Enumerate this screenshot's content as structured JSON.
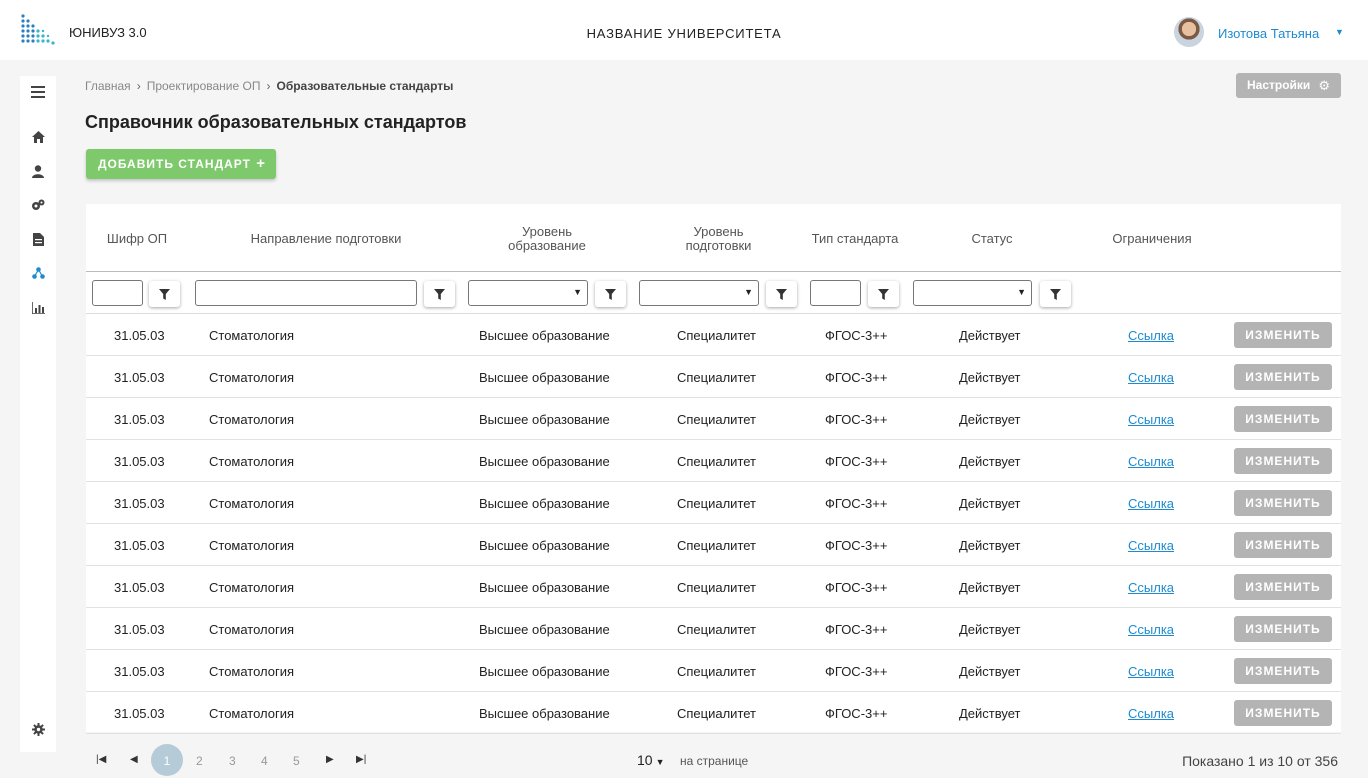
{
  "header": {
    "brand": "ЮНИВУЗ 3.0",
    "university": "НАЗВАНИЕ УНИВЕРСИТЕТА",
    "user_name": "Изотова Татьяна"
  },
  "sidebar": {
    "icons": [
      "menu-icon",
      "home-icon",
      "user-icon",
      "settings-gears-icon",
      "document-icon",
      "hierarchy-icon",
      "chart-icon",
      "gear-icon"
    ]
  },
  "breadcrumb": {
    "items": [
      "Главная",
      "Проектирование ОП",
      "Образовательные стандарты"
    ]
  },
  "settings_label": "Настройки",
  "page_title": "Справочник образовательных стандартов",
  "add_button_label": "ДОБАВИТЬ СТАНДАРТ",
  "table": {
    "headers": [
      "Шифр ОП",
      "Направление подготовки",
      "Уровень образование",
      "Уровень подготовки",
      "Тип стандарта",
      "Статус",
      "Ограничения"
    ],
    "link_label": "Ссылка",
    "edit_label": "ИЗМЕНИТЬ",
    "rows": [
      {
        "code": "31.05.03",
        "direction": "Стоматология",
        "edu_level": "Высшее образование",
        "prep_level": "Специалитет",
        "type": "ФГОС-3++",
        "status": "Действует"
      },
      {
        "code": "31.05.03",
        "direction": "Стоматология",
        "edu_level": "Высшее образование",
        "prep_level": "Специалитет",
        "type": "ФГОС-3++",
        "status": "Действует"
      },
      {
        "code": "31.05.03",
        "direction": "Стоматология",
        "edu_level": "Высшее образование",
        "prep_level": "Специалитет",
        "type": "ФГОС-3++",
        "status": "Действует"
      },
      {
        "code": "31.05.03",
        "direction": "Стоматология",
        "edu_level": "Высшее образование",
        "prep_level": "Специалитет",
        "type": "ФГОС-3++",
        "status": "Действует"
      },
      {
        "code": "31.05.03",
        "direction": "Стоматология",
        "edu_level": "Высшее образование",
        "prep_level": "Специалитет",
        "type": "ФГОС-3++",
        "status": "Действует"
      },
      {
        "code": "31.05.03",
        "direction": "Стоматология",
        "edu_level": "Высшее образование",
        "prep_level": "Специалитет",
        "type": "ФГОС-3++",
        "status": "Действует"
      },
      {
        "code": "31.05.03",
        "direction": "Стоматология",
        "edu_level": "Высшее образование",
        "prep_level": "Специалитет",
        "type": "ФГОС-3++",
        "status": "Действует"
      },
      {
        "code": "31.05.03",
        "direction": "Стоматология",
        "edu_level": "Высшее образование",
        "prep_level": "Специалитет",
        "type": "ФГОС-3++",
        "status": "Действует"
      },
      {
        "code": "31.05.03",
        "direction": "Стоматология",
        "edu_level": "Высшее образование",
        "prep_level": "Специалитет",
        "type": "ФГОС-3++",
        "status": "Действует"
      },
      {
        "code": "31.05.03",
        "direction": "Стоматология",
        "edu_level": "Высшее образование",
        "prep_level": "Специалитет",
        "type": "ФГОС-3++",
        "status": "Действует"
      }
    ]
  },
  "pagination": {
    "pages": [
      "1",
      "2",
      "3",
      "4",
      "5"
    ],
    "current": "1",
    "per_page": "10",
    "per_page_label": "на странице",
    "shown": "Показано 1 из 10 от 356"
  }
}
